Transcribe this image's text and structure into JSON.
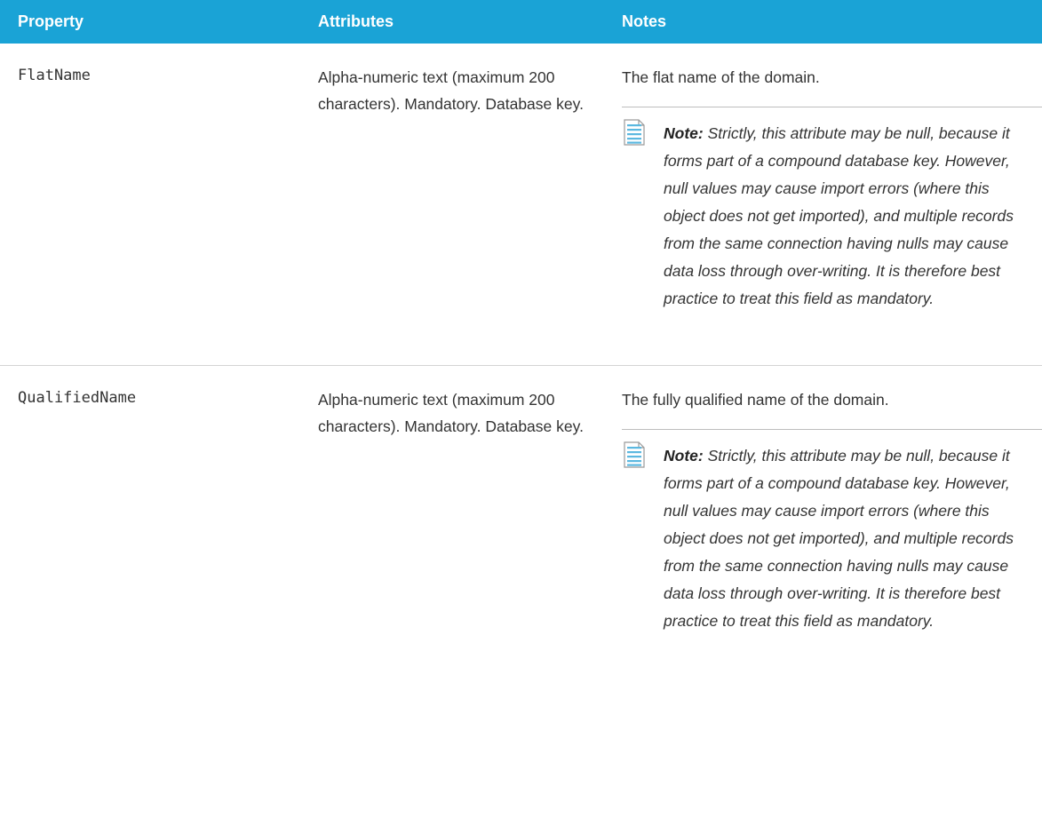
{
  "table": {
    "headers": {
      "property": "Property",
      "attributes": "Attributes",
      "notes": "Notes"
    },
    "rows": [
      {
        "property": "FlatName",
        "attributes": "Alpha-numeric text (maximum 200 characters). Mandatory. Database key.",
        "notes": "The flat name of the domain.",
        "note_label": "Note:",
        "note_text": "Strictly, this attribute may be null, because it forms part of a compound database key. However, null values may cause import errors (where this object does not get imported), and multiple records from the same connection having nulls may cause data loss through over-writing. It is therefore best practice to treat this field as mandatory."
      },
      {
        "property": "QualifiedName",
        "attributes": "Alpha-numeric text (maximum 200 characters). Mandatory. Database key.",
        "notes": "The fully qualified name of the domain.",
        "note_label": "Note:",
        "note_text": "Strictly, this attribute may be null, because it forms part of a compound database key. However, null values may cause import errors (where this object does not get imported), and multiple records from the same connection having nulls may cause data loss through over-writing. It is therefore best practice to treat this field as mandatory."
      }
    ]
  },
  "colors": {
    "header_bg": "#1aa3d6",
    "header_text": "#ffffff",
    "body_text": "#333333",
    "note_icon": "#5bb8e0"
  },
  "icons": {
    "note": "note-document-icon"
  }
}
